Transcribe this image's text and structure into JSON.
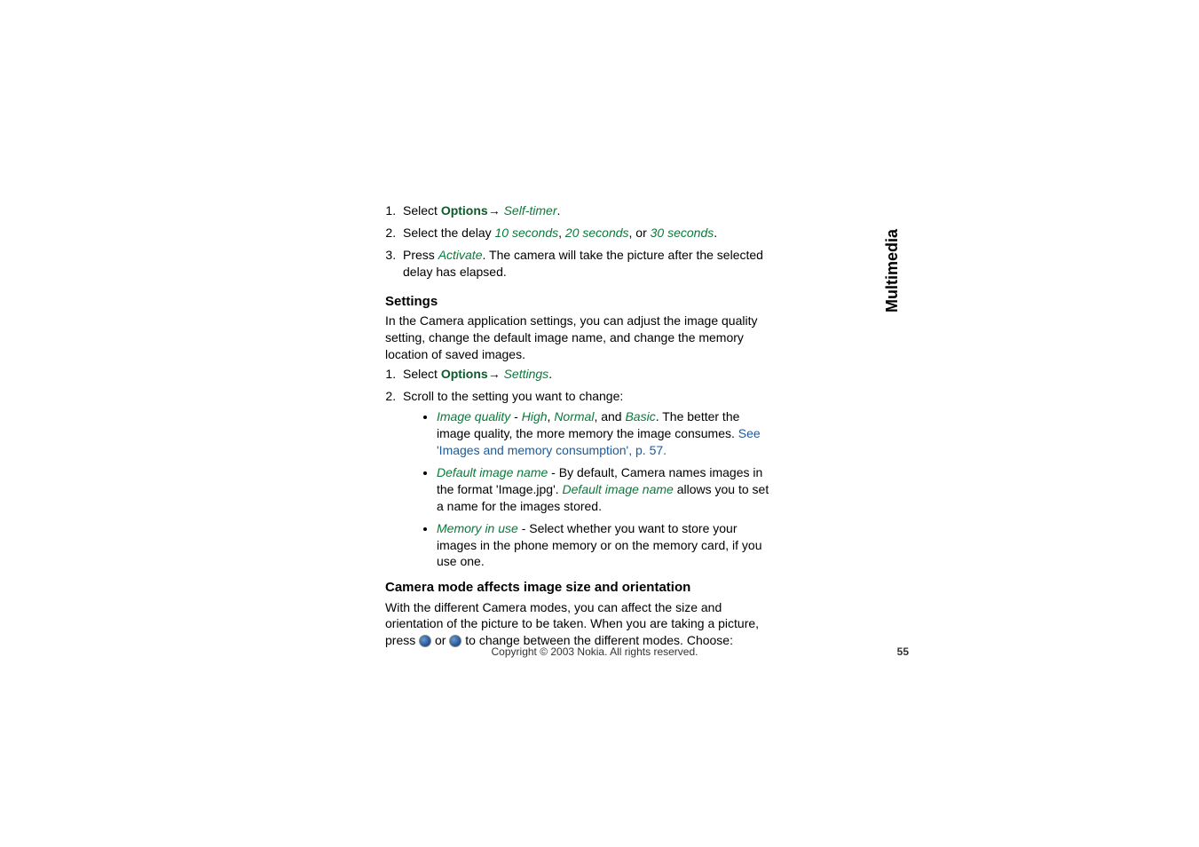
{
  "side_label": "Multimedia",
  "list1": {
    "item1_prefix": "Select ",
    "item1_options": "Options",
    "item1_arrow": "→",
    "item1_selftimer": " Self-timer",
    "item1_period": ".",
    "item2_prefix": "Select the delay  ",
    "item2_opt1": "10 seconds",
    "item2_comma1": ", ",
    "item2_opt2": "20 seconds",
    "item2_comma2": ", or ",
    "item2_opt3": "30 seconds",
    "item2_period": ".",
    "item3_prefix": "Press ",
    "item3_activate": "Activate",
    "item3_rest": ". The camera will take the picture after the selected delay has elapsed."
  },
  "settings": {
    "heading": "Settings",
    "intro": "In the Camera application settings, you can adjust the image quality setting, change the default image name, and change the memory location of saved images.",
    "step1_prefix": "Select ",
    "step1_options": "Options",
    "step1_arrow": "→",
    "step1_settings": " Settings",
    "step1_period": ".",
    "step2": "Scroll to the setting you want to change:",
    "bullet1_iq": "Image quality",
    "bullet1_dash": " - ",
    "bullet1_high": "High",
    "bullet1_c1": ", ",
    "bullet1_normal": "Normal",
    "bullet1_c2": ", and ",
    "bullet1_basic": "Basic",
    "bullet1_rest1": ". The better the image quality, the more memory the image consumes. ",
    "bullet1_link": "See 'Images and memory consumption', p. 57.",
    "bullet2_din": "Default image name",
    "bullet2_mid1": " - By default, Camera names images in the format 'Image.jpg'. ",
    "bullet2_din2": "Default image name",
    "bullet2_rest": " allows you to set a name for the images stored.",
    "bullet3_miu": "Memory in use",
    "bullet3_rest": " - Select whether you want to store your images in the phone memory or on the memory card, if you use one."
  },
  "camera_mode": {
    "heading": "Camera mode affects image size and orientation",
    "text1": "With the different Camera modes, you can affect the size and orientation of the picture to be taken. When you are taking a picture, press ",
    "or": " or ",
    "text2": " to change between the different modes. Choose:"
  },
  "footer": {
    "copyright": "Copyright © 2003 Nokia. All rights reserved.",
    "page_number": "55"
  }
}
